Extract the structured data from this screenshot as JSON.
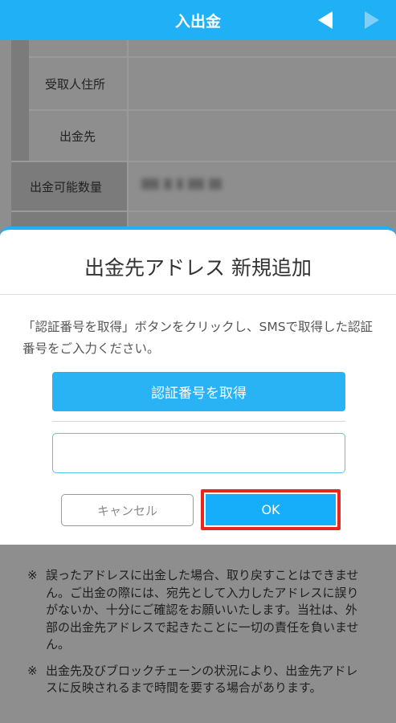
{
  "header": {
    "title": "入出金"
  },
  "background": {
    "rows": [
      {
        "label": "受取人住所"
      },
      {
        "label": "出金先"
      },
      {
        "label": "出金可能数量"
      }
    ]
  },
  "modal": {
    "title": "出金先アドレス 新規追加",
    "description": "「認証番号を取得」ボタンをクリックし、SMSで取得した認証番号をご入力ください。",
    "get_code_label": "認証番号を取得",
    "code_input": {
      "value": "",
      "placeholder": ""
    },
    "cancel_label": "キャンセル",
    "ok_label": "OK"
  },
  "notes": [
    {
      "mark": "※",
      "text": "誤ったアドレスに出金した場合、取り戻すことはできません。ご出金の際には、宛先として入力したアドレスに誤りがないか、十分にご確認をお願いいたします。当社は、外部の出金先アドレスで起きたことに一切の責任を負いません。"
    },
    {
      "mark": "※",
      "text": "出金先及びブロックチェーンの状況により、出金先アドレスに反映されるまで時間を要する場合があります。"
    }
  ],
  "colors": {
    "accent": "#1fb0f5",
    "highlight": "#e8281e",
    "overlay": "#8e8e8e"
  }
}
